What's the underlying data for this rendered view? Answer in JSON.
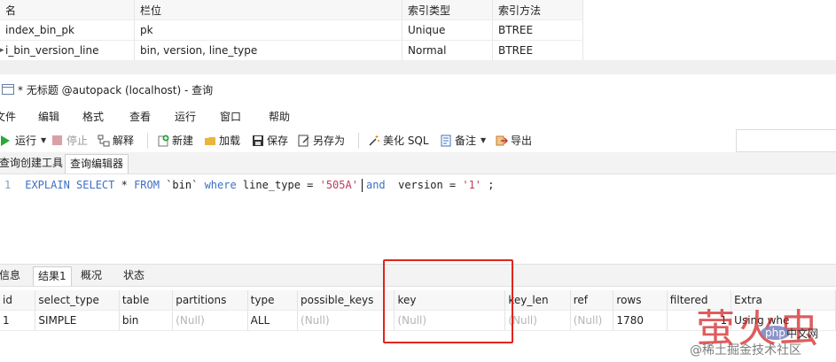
{
  "index_table": {
    "headers": [
      "名",
      "栏位",
      "索引类型",
      "索引方法"
    ],
    "rows": [
      [
        "index_bin_pk",
        "pk",
        "Unique",
        "BTREE"
      ],
      [
        "i_bin_version_line",
        "bin, version, line_type",
        "Normal",
        "BTREE"
      ]
    ]
  },
  "window": {
    "title": "* 无标题 @autopack (localhost) - 查询"
  },
  "menu": {
    "items": [
      "文件",
      "编辑",
      "格式",
      "查看",
      "运行",
      "窗口",
      "帮助"
    ]
  },
  "toolbar": {
    "run": "运行",
    "stop": "停止",
    "explain": "解释",
    "new": "新建",
    "load": "加载",
    "save": "保存",
    "save_as": "另存为",
    "beautify": "美化 SQL",
    "comment": "备注",
    "export": "导出"
  },
  "editor_tabs": [
    "查询创建工具",
    "查询编辑器"
  ],
  "editor": {
    "line_number": "1",
    "tokens": {
      "kw1": "EXPLAIN SELECT",
      "t1": " * ",
      "kw2": "FROM",
      "t2": " `bin` ",
      "kw3": "where",
      "t3": " line_type = ",
      "s1": "'505A'",
      "kw4": "and",
      "t4": "  version = ",
      "s2": "'1'",
      "t5": " ;"
    }
  },
  "result_tabs": [
    "信息",
    "结果1",
    "概况",
    "状态"
  ],
  "result_grid": {
    "headers": [
      "id",
      "select_type",
      "table",
      "partitions",
      "type",
      "possible_keys",
      "key",
      "key_len",
      "ref",
      "rows",
      "filtered",
      "Extra"
    ],
    "row": [
      "1",
      "SIMPLE",
      "bin",
      "(Null)",
      "ALL",
      "(Null)",
      "(Null)",
      "(Null)",
      "(Null)",
      "1780",
      "1",
      "Using whe"
    ]
  },
  "watermark": {
    "big": "萤火虫",
    "php": "php",
    "cn": "中文网",
    "small": "@稀土掘金技术社区"
  },
  "colors": {
    "highlight": "#e0251b",
    "keyword": "#3d6fc7",
    "string": "#c23b5e"
  }
}
